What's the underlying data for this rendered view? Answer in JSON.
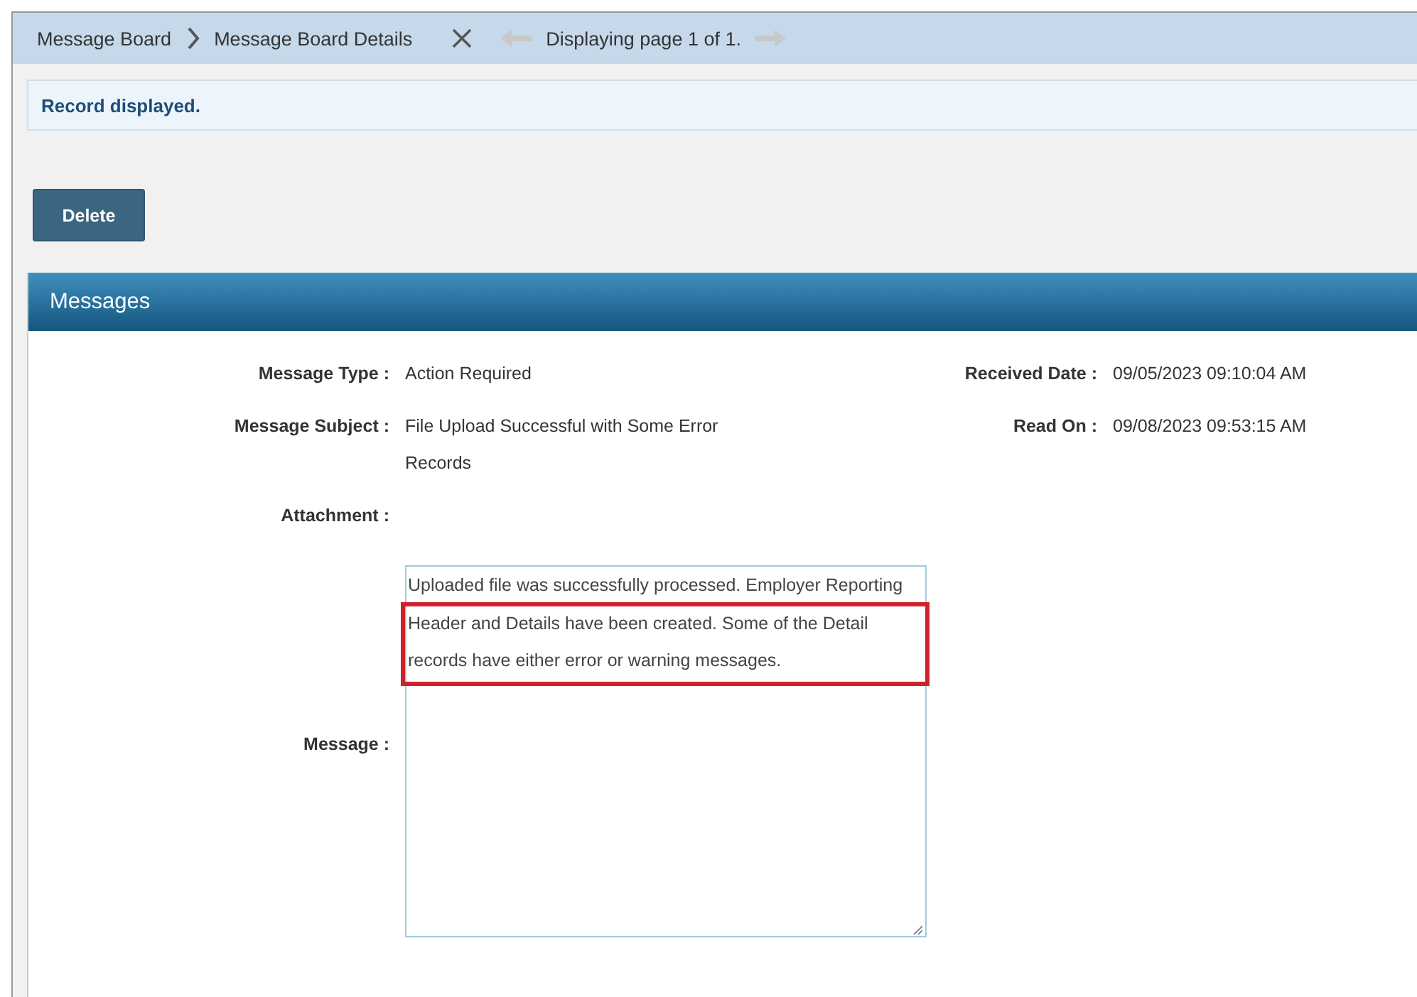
{
  "breadcrumb": [
    {
      "label": "Message Board"
    },
    {
      "label": "Message Board Details"
    }
  ],
  "pager": {
    "text": "Displaying page 1 of 1.",
    "previous_disabled": true,
    "next_disabled": true
  },
  "notice": "Record displayed.",
  "buttons": [
    "Delete"
  ],
  "section": {
    "title": "Messages",
    "left_fields": [
      {
        "label": "Message Type :",
        "value": "Action Required"
      },
      {
        "label": "Message Subject :",
        "value": "File Upload Successful with Some Error Records"
      },
      {
        "label": "Attachment :"
      }
    ],
    "right_fields": [
      {
        "label": "Received Date :",
        "value": "09/05/2023 09:10:04 AM"
      },
      {
        "label": "Read On :",
        "value": "09/08/2023 09:53:15 AM"
      }
    ],
    "message": {
      "label": "Message :",
      "value": "Uploaded file was successfully processed. Employer Reporting Header and Details have been created. Some of the Detail records have either error or warning messages.",
      "highlighted": true
    }
  }
}
